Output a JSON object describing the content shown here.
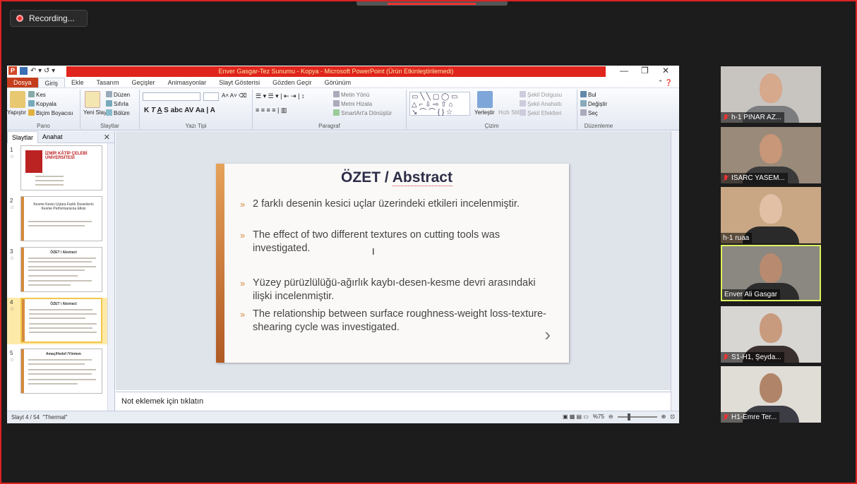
{
  "recording": {
    "label": "Recording..."
  },
  "ppt": {
    "window_title": "Enver Gasgar-Tez Sunumu - Kopya - Microsoft PowerPoint (Ürün Etkinleştirilemedi)",
    "tabs": [
      "Dosya",
      "Giriş",
      "Ekle",
      "Tasarım",
      "Geçişler",
      "Animasyonlar",
      "Slayt Gösterisi",
      "Gözden Geçir",
      "Görünüm"
    ],
    "ribbon": {
      "pano": {
        "label": "Pano",
        "yapistir": "Yapıştır",
        "kes": "Kes",
        "kopyala": "Kopyala",
        "bicim": "Biçim Boyacısı"
      },
      "slaytlar": {
        "label": "Slaytlar",
        "yeni": "Yeni Slayt",
        "duzen": "Düzen",
        "sifirla": "Sıfırla",
        "bolum": "Bölüm"
      },
      "yazi_tipi": {
        "label": "Yazı Tipi"
      },
      "paragraf": {
        "label": "Paragraf",
        "metin_yonu": "Metin Yönü",
        "metni_hizala": "Metni Hizala",
        "smartart": "SmartArt'a Dönüştür"
      },
      "cizim": {
        "label": "Çizim",
        "yerlestir": "Yerleştir",
        "hizli": "Hızlı Stiller",
        "dolgu": "Şekil Dolgusu",
        "anahat": "Şekil Anahattı",
        "efekt": "Şekil Efektleri"
      },
      "duzenleme": {
        "label": "Düzenleme",
        "bul": "Bul",
        "degistir": "Değiştir",
        "sec": "Seç"
      }
    },
    "left_tabs": {
      "slaytlar": "Slaytlar",
      "anahat": "Anahat"
    },
    "thumbnails": [
      {
        "num": "1",
        "title": "İZMİR KÂTİP ÇELEBİ ÜNİVERSİTESİ"
      },
      {
        "num": "2",
        "title": "Kesme Kesici Uçlara Farklı Desenlerin Kesme Performansına Etkisi"
      },
      {
        "num": "3",
        "title": "ÖZET / Abstract"
      },
      {
        "num": "4",
        "title": "ÖZET / Abstract"
      },
      {
        "num": "5",
        "title": "Amaç/Hedef /Yöntem"
      }
    ],
    "slide": {
      "title_a": "ÖZET / ",
      "title_b": "Abstract",
      "bullets": [
        "2 farklı desenin kesici uçlar üzerindeki etkileri incelenmiştir.",
        "The effect of two different textures on cutting tools was investigated.",
        "Yüzey pürüzlülüğü-ağırlık kaybı-desen-kesme devri arasındaki ilişki incelenmiştir.",
        "The relationship between surface roughness-weight loss-texture-shearing cycle was investigated."
      ]
    },
    "notes_placeholder": "Not eklemek için tıklatın",
    "status": {
      "slide": "Slayt 4 / 54",
      "theme": "\"Thermal\"",
      "zoom": "%75"
    }
  },
  "participants": [
    {
      "name": "h-1 PINAR AZ...",
      "muted": true
    },
    {
      "name": "ISARC YASEM...",
      "muted": true
    },
    {
      "name": "h-1 ruaa",
      "muted": false
    },
    {
      "name": "Enver Ali Gasgar",
      "muted": false
    },
    {
      "name": "S1-H1, Şeyda...",
      "muted": true
    },
    {
      "name": "H1-Emre Ter...",
      "muted": true
    }
  ]
}
